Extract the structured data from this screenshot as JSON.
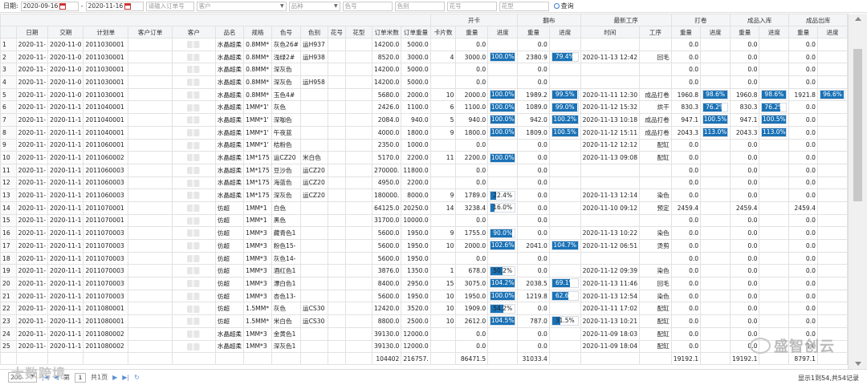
{
  "filter": {
    "date_label": "日期:",
    "date_from": "2020-09-16",
    "date_sep": "-",
    "date_to": "2020-11-16",
    "order_placeholder": "请输入订单号",
    "customer_placeholder": "客户",
    "product_placeholder": "品种",
    "color_no_placeholder": "色号",
    "color_cat_placeholder": "色别",
    "pattern_no_placeholder": "花号",
    "pattern_type_placeholder": "花型",
    "query_label": "查询"
  },
  "header": {
    "groups": {
      "open": "开卡",
      "cloth": "翻布",
      "latest": "最新工序",
      "roll": "打卷",
      "stock_in": "成品入库",
      "stock_out": "成品出库"
    },
    "cols": [
      "日期",
      "交期",
      "计划单",
      "客户订单",
      "客户",
      "品名",
      "规格",
      "色号",
      "色别",
      "花号",
      "花型",
      "订单米数",
      "订单重量",
      "卡片数",
      "重量",
      "进度",
      "重量",
      "进度",
      "时间",
      "工序",
      "重量",
      "进度",
      "重量",
      "进度",
      "重量",
      "进度"
    ]
  },
  "rows": [
    {
      "n": "1",
      "date": "2020-11-",
      "due": "2020-11-0",
      "plan": "2011030001",
      "name": "水晶超柔",
      "spec": "0.8MM*",
      "cno": "灰色26#",
      "ccat": "运H937",
      "om": "14200.0",
      "ow": "5000.0",
      "cards": "",
      "ow2": "0.0",
      "op": null,
      "cw": "0.0",
      "cp": null,
      "time": "",
      "proc": "",
      "rw": "0.0",
      "rp": null,
      "iw": "0.0",
      "ip": null,
      "xw": "0.0",
      "xp": null
    },
    {
      "n": "2",
      "date": "2020-11-",
      "due": "2020-11-0",
      "plan": "2011030001",
      "name": "水晶超柔",
      "spec": "0.8MM*",
      "cno": "浅绿2#",
      "ccat": "运H938",
      "om": "8520.0",
      "ow": "3000.0",
      "cards": "4",
      "ow2": "3000.0",
      "op": "100.0%",
      "cw": "2380.9",
      "cp": "79.4%",
      "time": "2020-11-13 12:42",
      "proc": "回毛",
      "rw": "0.0",
      "rp": null,
      "iw": "0.0",
      "ip": null,
      "xw": "0.0",
      "xp": null
    },
    {
      "n": "3",
      "date": "2020-11-",
      "due": "2020-11-0",
      "plan": "2011030001",
      "name": "水晶超柔",
      "spec": "0.8MM*",
      "cno": "深灰色",
      "ccat": "",
      "om": "14200.0",
      "ow": "5000.0",
      "cards": "",
      "ow2": "0.0",
      "op": null,
      "cw": "0.0",
      "cp": null,
      "time": "",
      "proc": "",
      "rw": "0.0",
      "rp": null,
      "iw": "0.0",
      "ip": null,
      "xw": "0.0",
      "xp": null
    },
    {
      "n": "4",
      "date": "2020-11-",
      "due": "2020-11-0",
      "plan": "2011030001",
      "name": "水晶超柔",
      "spec": "0.8MM*",
      "cno": "深灰色",
      "ccat": "运H958",
      "om": "14200.0",
      "ow": "5000.0",
      "cards": "",
      "ow2": "0.0",
      "op": null,
      "cw": "0.0",
      "cp": null,
      "time": "",
      "proc": "",
      "rw": "0.0",
      "rp": null,
      "iw": "0.0",
      "ip": null,
      "xw": "0.0",
      "xp": null
    },
    {
      "n": "5",
      "date": "2020-11-",
      "due": "2020-11-0",
      "plan": "2011030001",
      "name": "水晶超柔",
      "spec": "0.8MM*",
      "cno": "玉色4#",
      "ccat": "",
      "om": "5680.0",
      "ow": "2000.0",
      "cards": "10",
      "ow2": "2000.0",
      "op": "100.0%",
      "cw": "1989.2",
      "cp": "99.5%",
      "time": "2020-11-11 12:30",
      "proc": "成品打卷",
      "rw": "1960.8",
      "rp": "98.6%",
      "iw": "1960.8",
      "ip": "98.6%",
      "xw": "1921.8",
      "xp": "96.6%"
    },
    {
      "n": "6",
      "date": "2020-11-",
      "due": "2020-11-1",
      "plan": "2011040001",
      "name": "水晶超柔",
      "spec": "1MM*1'",
      "cno": "灰色",
      "ccat": "",
      "om": "2426.0",
      "ow": "1100.0",
      "cards": "6",
      "ow2": "1100.0",
      "op": "100.0%",
      "cw": "1089.0",
      "cp": "99.0%",
      "time": "2020-11-12 15:32",
      "proc": "烘干",
      "rw": "830.3",
      "rp": "76.2%",
      "iw": "830.3",
      "ip": "76.2%",
      "xw": "0.0",
      "xp": null
    },
    {
      "n": "7",
      "date": "2020-11-",
      "due": "2020-11-1",
      "plan": "2011040001",
      "name": "水晶超柔",
      "spec": "1MM*1'",
      "cno": "深咖色",
      "ccat": "",
      "om": "2084.0",
      "ow": "940.0",
      "cards": "5",
      "ow2": "940.0",
      "op": "100.0%",
      "cw": "942.0",
      "cp": "100.2%",
      "time": "2020-11-13 10:18",
      "proc": "成品打卷",
      "rw": "947.1",
      "rp": "100.5%",
      "iw": "947.1",
      "ip": "100.5%",
      "xw": "0.0",
      "xp": null
    },
    {
      "n": "8",
      "date": "2020-11-",
      "due": "2020-11-1",
      "plan": "2011040001",
      "name": "水晶超柔",
      "spec": "1MM*1'",
      "cno": "午夜蓝",
      "ccat": "",
      "om": "4000.0",
      "ow": "1800.0",
      "cards": "9",
      "ow2": "1800.0",
      "op": "100.0%",
      "cw": "1809.0",
      "cp": "100.5%",
      "time": "2020-11-12 15:11",
      "proc": "成品打卷",
      "rw": "2043.3",
      "rp": "113.0%",
      "iw": "2043.3",
      "ip": "113.0%",
      "xw": "0.0",
      "xp": null
    },
    {
      "n": "9",
      "date": "2020-11-",
      "due": "2020-11-1",
      "plan": "2011060001",
      "name": "水晶超柔",
      "spec": "1MM*1'",
      "cno": "桔粉色",
      "ccat": "",
      "om": "2350.0",
      "ow": "1000.0",
      "cards": "",
      "ow2": "0.0",
      "op": null,
      "cw": "0.0",
      "cp": null,
      "time": "2020-11-12 12:12",
      "proc": "配缸",
      "rw": "0.0",
      "rp": null,
      "iw": "0.0",
      "ip": null,
      "xw": "0.0",
      "xp": null
    },
    {
      "n": "10",
      "date": "2020-11-",
      "due": "2020-11-1",
      "plan": "2011060002",
      "name": "水晶超柔",
      "spec": "1M*175",
      "cno": "运CZ20",
      "ccat": "米白色",
      "om": "5170.0",
      "ow": "2200.0",
      "cards": "11",
      "ow2": "2200.0",
      "op": "100.0%",
      "cw": "0.0",
      "cp": null,
      "time": "2020-11-13 09:08",
      "proc": "配缸",
      "rw": "0.0",
      "rp": null,
      "iw": "0.0",
      "ip": null,
      "xw": "0.0",
      "xp": null
    },
    {
      "n": "11",
      "date": "2020-11-",
      "due": "2020-11-1",
      "plan": "2011060003",
      "name": "水晶超柔",
      "spec": "1M*175",
      "cno": "豆沙色",
      "ccat": "运CZ20",
      "om": "270000.",
      "ow": "11800.0",
      "cards": "",
      "ow2": "0.0",
      "op": null,
      "cw": "0.0",
      "cp": null,
      "time": "",
      "proc": "",
      "rw": "0.0",
      "rp": null,
      "iw": "0.0",
      "ip": null,
      "xw": "0.0",
      "xp": null
    },
    {
      "n": "12",
      "date": "2020-11-",
      "due": "2020-11-1",
      "plan": "2011060003",
      "name": "水晶超柔",
      "spec": "1M*175",
      "cno": "海蓝色",
      "ccat": "运CZ20",
      "om": "4950.0",
      "ow": "2200.0",
      "cards": "",
      "ow2": "0.0",
      "op": null,
      "cw": "0.0",
      "cp": null,
      "time": "",
      "proc": "",
      "rw": "0.0",
      "rp": null,
      "iw": "0.0",
      "ip": null,
      "xw": "0.0",
      "xp": null
    },
    {
      "n": "13",
      "date": "2020-11-",
      "due": "2020-11-1",
      "plan": "2011060003",
      "name": "水晶超柔",
      "spec": "1M*175",
      "cno": "深灰色",
      "ccat": "运CZ20",
      "om": "180000.",
      "ow": "8000.0",
      "cards": "9",
      "ow2": "1789.0",
      "op": "22.4%",
      "cw": "0.0",
      "cp": null,
      "time": "2020-11-13 12:14",
      "proc": "染色",
      "rw": "0.0",
      "rp": null,
      "iw": "0.0",
      "ip": null,
      "xw": "0.0",
      "xp": null
    },
    {
      "n": "14",
      "date": "2020-11-",
      "due": "2020-11-1",
      "plan": "2011070001",
      "name": "仿超",
      "spec": "1MM*1",
      "cno": "白色",
      "ccat": "",
      "om": "64125.0",
      "ow": "20250.0",
      "cards": "14",
      "ow2": "3238.4",
      "op": "16.0%",
      "cw": "0.0",
      "cp": null,
      "time": "2020-11-10 09:12",
      "proc": "预定",
      "rw": "2459.4",
      "rp": null,
      "iw": "2459.4",
      "ip": null,
      "xw": "2459.4",
      "xp": null
    },
    {
      "n": "15",
      "date": "2020-11-",
      "due": "2020-11-1",
      "plan": "2011070001",
      "name": "仿超",
      "spec": "1MM*1",
      "cno": "黑色",
      "ccat": "",
      "om": "31700.0",
      "ow": "10000.0",
      "cards": "",
      "ow2": "0.0",
      "op": null,
      "cw": "0.0",
      "cp": null,
      "time": "",
      "proc": "",
      "rw": "0.0",
      "rp": null,
      "iw": "0.0",
      "ip": null,
      "xw": "0.0",
      "xp": null
    },
    {
      "n": "16",
      "date": "2020-11-",
      "due": "2020-11-1",
      "plan": "2011070003",
      "name": "仿超",
      "spec": "1MM*3",
      "cno": "藏青色1",
      "ccat": "",
      "om": "5600.0",
      "ow": "1950.0",
      "cards": "9",
      "ow2": "1755.0",
      "op": "90.0%",
      "cw": "0.0",
      "cp": null,
      "time": "2020-11-13 10:22",
      "proc": "染色",
      "rw": "0.0",
      "rp": null,
      "iw": "0.0",
      "ip": null,
      "xw": "0.0",
      "xp": null
    },
    {
      "n": "17",
      "date": "2020-11-",
      "due": "2020-11-1",
      "plan": "2011070003",
      "name": "仿超",
      "spec": "1MM*3",
      "cno": "粉色15-",
      "ccat": "",
      "om": "5600.0",
      "ow": "1950.0",
      "cards": "10",
      "ow2": "2000.0",
      "op": "102.6%",
      "cw": "2041.0",
      "cp": "104.7%",
      "time": "2020-11-12 06:51",
      "proc": "烫剪",
      "rw": "0.0",
      "rp": null,
      "iw": "0.0",
      "ip": null,
      "xw": "0.0",
      "xp": null
    },
    {
      "n": "18",
      "date": "2020-11-",
      "due": "2020-11-1",
      "plan": "2011070003",
      "name": "仿超",
      "spec": "1MM*3",
      "cno": "灰色14-",
      "ccat": "",
      "om": "5600.0",
      "ow": "1950.0",
      "cards": "",
      "ow2": "0.0",
      "op": null,
      "cw": "0.0",
      "cp": null,
      "time": "",
      "proc": "",
      "rw": "0.0",
      "rp": null,
      "iw": "0.0",
      "ip": null,
      "xw": "0.0",
      "xp": null
    },
    {
      "n": "19",
      "date": "2020-11-",
      "due": "2020-11-1",
      "plan": "2011070003",
      "name": "仿超",
      "spec": "1MM*3",
      "cno": "酒红色1",
      "ccat": "",
      "om": "3876.0",
      "ow": "1350.0",
      "cards": "1",
      "ow2": "678.0",
      "op": "50.2%",
      "cw": "0.0",
      "cp": null,
      "time": "2020-11-12 09:39",
      "proc": "染色",
      "rw": "0.0",
      "rp": null,
      "iw": "0.0",
      "ip": null,
      "xw": "0.0",
      "xp": null
    },
    {
      "n": "20",
      "date": "2020-11-",
      "due": "2020-11-1",
      "plan": "2011070003",
      "name": "仿超",
      "spec": "1MM*3",
      "cno": "漂白色1",
      "ccat": "",
      "om": "8400.0",
      "ow": "2950.0",
      "cards": "15",
      "ow2": "3075.0",
      "op": "104.2%",
      "cw": "2038.5",
      "cp": "69.1%",
      "time": "2020-11-13 11:46",
      "proc": "回毛",
      "rw": "0.0",
      "rp": null,
      "iw": "0.0",
      "ip": null,
      "xw": "0.0",
      "xp": null
    },
    {
      "n": "21",
      "date": "2020-11-",
      "due": "2020-11-1",
      "plan": "2011070003",
      "name": "仿超",
      "spec": "1MM*3",
      "cno": "杏色13-",
      "ccat": "",
      "om": "5600.0",
      "ow": "1950.0",
      "cards": "10",
      "ow2": "1950.0",
      "op": "100.0%",
      "cw": "1219.8",
      "cp": "62.6%",
      "time": "2020-11-13 12:54",
      "proc": "染色",
      "rw": "0.0",
      "rp": null,
      "iw": "0.0",
      "ip": null,
      "xw": "0.0",
      "xp": null
    },
    {
      "n": "22",
      "date": "2020-11-",
      "due": "2020-11-1",
      "plan": "2011080001",
      "name": "仿超",
      "spec": "1.5MM*",
      "cno": "灰色",
      "ccat": "运CS30",
      "om": "12420.0",
      "ow": "3520.0",
      "cards": "10",
      "ow2": "1909.0",
      "op": "54.2%",
      "cw": "0.0",
      "cp": null,
      "time": "2020-11-11 17:02",
      "proc": "配缸",
      "rw": "0.0",
      "rp": null,
      "iw": "0.0",
      "ip": null,
      "xw": "0.0",
      "xp": null
    },
    {
      "n": "23",
      "date": "2020-11-",
      "due": "2020-11-1",
      "plan": "2011080001",
      "name": "仿超",
      "spec": "1.5MM*",
      "cno": "米白色",
      "ccat": "运CS30",
      "om": "8800.0",
      "ow": "2500.0",
      "cards": "10",
      "ow2": "2612.0",
      "op": "104.5%",
      "cw": "787.0",
      "cp": "31.5%",
      "time": "2020-11-13 10:21",
      "proc": "配缸",
      "rw": "0.0",
      "rp": null,
      "iw": "0.0",
      "ip": null,
      "xw": "0.0",
      "xp": null
    },
    {
      "n": "24",
      "date": "2020-11-",
      "due": "2020-11-1",
      "plan": "2011080002",
      "name": "水晶超柔",
      "spec": "1MM*3",
      "cno": "金黄色1",
      "ccat": "",
      "om": "39130.0",
      "ow": "12000.0",
      "cards": "",
      "ow2": "0.0",
      "op": null,
      "cw": "0.0",
      "cp": null,
      "time": "2020-11-09 18:03",
      "proc": "配缸",
      "rw": "0.0",
      "rp": null,
      "iw": "0.0",
      "ip": null,
      "xw": "0.0",
      "xp": null
    },
    {
      "n": "25",
      "date": "2020-11-",
      "due": "2020-11-1",
      "plan": "2011080002",
      "name": "水晶超柔",
      "spec": "1MM*3",
      "cno": "深灰色1",
      "ccat": "",
      "om": "39130.0",
      "ow": "12000.0",
      "cards": "",
      "ow2": "0.0",
      "op": null,
      "cw": "0.0",
      "cp": null,
      "time": "2020-11-09 18:04",
      "proc": "配缸",
      "rw": "0.0",
      "rp": null,
      "iw": "0.0",
      "ip": null,
      "xw": "0.0",
      "xp": null
    }
  ],
  "totals": {
    "om": "104402",
    "ow": "216757.",
    "ow2": "86471.5",
    "cw": "31033.4",
    "rw": "19192.1",
    "iw": "19192.1",
    "xw": "8797.1"
  },
  "pager": {
    "page_size": "200",
    "page_label": "第",
    "page_no": "1",
    "of_label": "共1页",
    "info": "显示1到54,共54记录"
  },
  "watermark": {
    "text": "盛智创云",
    "text2": "大数跨境"
  },
  "colors": {
    "progress_fill": "#1a72b6",
    "header_bg": "#f4f5f7"
  }
}
